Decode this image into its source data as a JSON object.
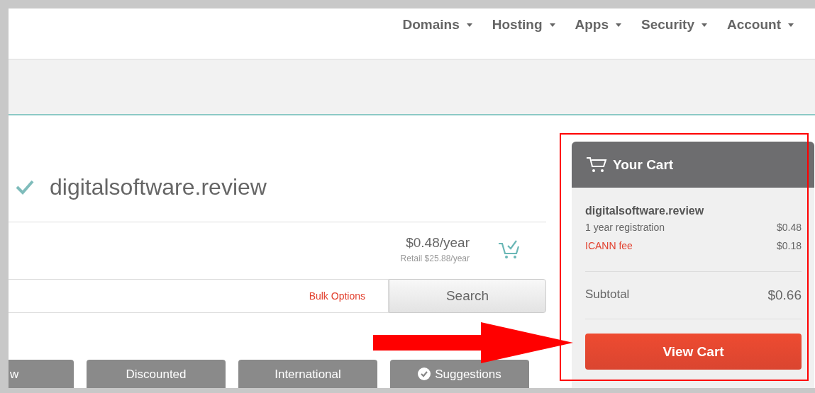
{
  "nav": [
    {
      "label": "Domains"
    },
    {
      "label": "Hosting"
    },
    {
      "label": "Apps"
    },
    {
      "label": "Security"
    },
    {
      "label": "Account"
    }
  ],
  "result": {
    "domain": "digitalsoftware.review",
    "available": true,
    "price": "$0.48/year",
    "retail": "Retail $25.88/year",
    "in_cart": true
  },
  "search": {
    "bulk_options": "Bulk Options",
    "button": "Search"
  },
  "filters": [
    {
      "label": "w",
      "checked": false
    },
    {
      "label": "Discounted",
      "checked": false
    },
    {
      "label": "International",
      "checked": false
    },
    {
      "label": "Suggestions",
      "checked": true
    }
  ],
  "cart": {
    "title": "Your Cart",
    "domain": "digitalsoftware.review",
    "lines": [
      {
        "label": "1 year registration",
        "amount": "$0.48",
        "kind": "plain"
      },
      {
        "label": "ICANN fee",
        "amount": "$0.18",
        "kind": "fee"
      }
    ],
    "subtotal_label": "Subtotal",
    "subtotal": "$0.66",
    "button": "View Cart"
  }
}
